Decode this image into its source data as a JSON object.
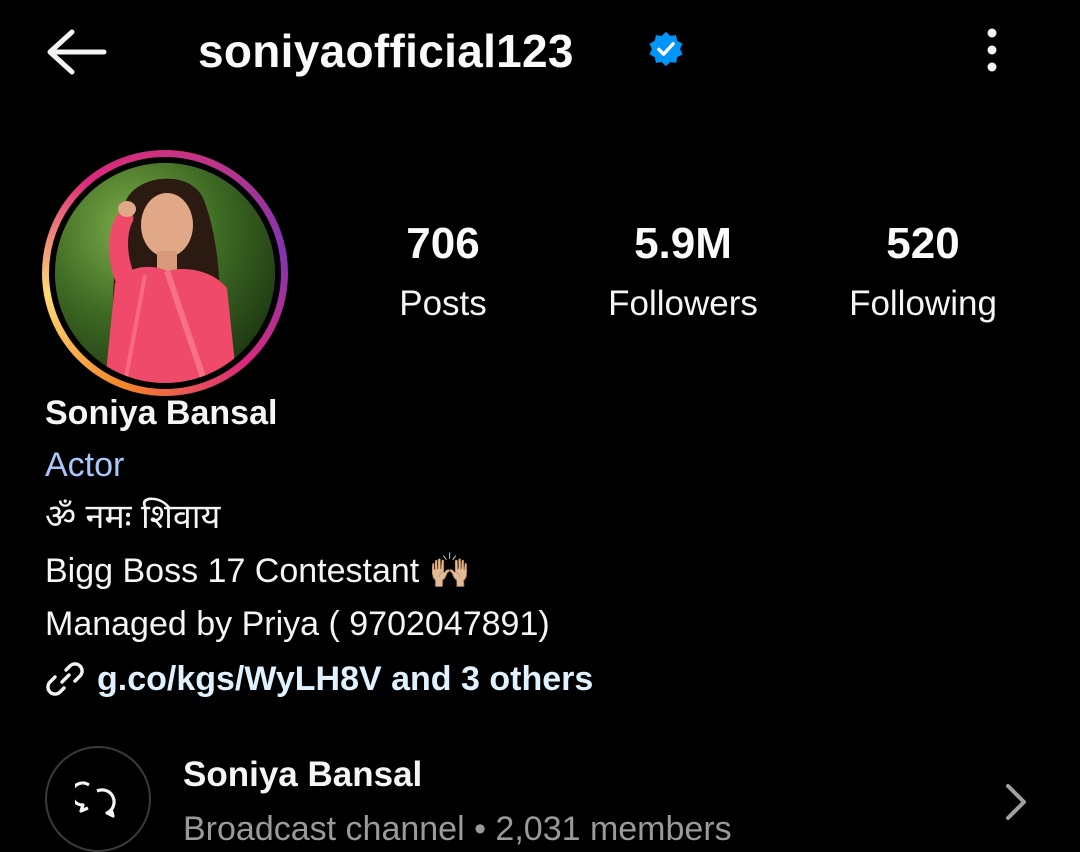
{
  "header": {
    "username": "soniyaofficial123",
    "verified": true,
    "back_icon": "arrow-left-icon",
    "menu_icon": "more-vertical-icon"
  },
  "stats": [
    {
      "value": "706",
      "label": "Posts"
    },
    {
      "value": "5.9M",
      "label": "Followers"
    },
    {
      "value": "520",
      "label": "Following"
    }
  ],
  "bio": {
    "name": "Soniya Bansal",
    "category": "Actor",
    "line1": "ॐ नमः शिवाय",
    "line2": "Bigg Boss 17 Contestant 🙌🏼",
    "line3": "Managed by Priya ( 9702047891)",
    "link": "g.co/kgs/WyLH8V and 3 others"
  },
  "channel": {
    "title": "Soniya Bansal",
    "subtitle": "Broadcast channel • 2,031 members"
  },
  "colors": {
    "background": "#000000",
    "verified_blue": "#0095f6",
    "category_blue": "#a8c7fa",
    "muted_text": "#9a9a9a"
  }
}
